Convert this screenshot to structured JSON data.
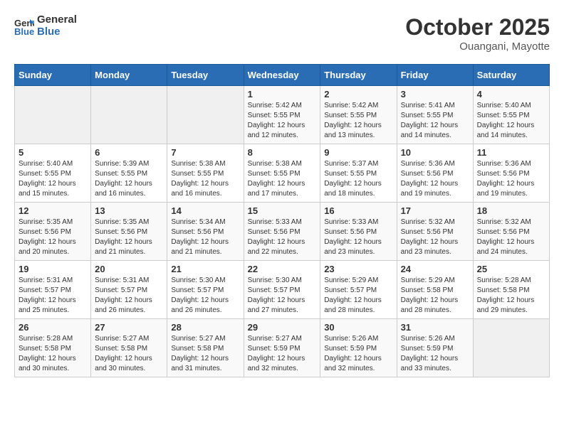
{
  "header": {
    "logo_line1": "General",
    "logo_line2": "Blue",
    "title": "October 2025",
    "subtitle": "Ouangani, Mayotte"
  },
  "days_of_week": [
    "Sunday",
    "Monday",
    "Tuesday",
    "Wednesday",
    "Thursday",
    "Friday",
    "Saturday"
  ],
  "weeks": [
    [
      {
        "day": "",
        "info": ""
      },
      {
        "day": "",
        "info": ""
      },
      {
        "day": "",
        "info": ""
      },
      {
        "day": "1",
        "info": "Sunrise: 5:42 AM\nSunset: 5:55 PM\nDaylight: 12 hours\nand 12 minutes."
      },
      {
        "day": "2",
        "info": "Sunrise: 5:42 AM\nSunset: 5:55 PM\nDaylight: 12 hours\nand 13 minutes."
      },
      {
        "day": "3",
        "info": "Sunrise: 5:41 AM\nSunset: 5:55 PM\nDaylight: 12 hours\nand 14 minutes."
      },
      {
        "day": "4",
        "info": "Sunrise: 5:40 AM\nSunset: 5:55 PM\nDaylight: 12 hours\nand 14 minutes."
      }
    ],
    [
      {
        "day": "5",
        "info": "Sunrise: 5:40 AM\nSunset: 5:55 PM\nDaylight: 12 hours\nand 15 minutes."
      },
      {
        "day": "6",
        "info": "Sunrise: 5:39 AM\nSunset: 5:55 PM\nDaylight: 12 hours\nand 16 minutes."
      },
      {
        "day": "7",
        "info": "Sunrise: 5:38 AM\nSunset: 5:55 PM\nDaylight: 12 hours\nand 16 minutes."
      },
      {
        "day": "8",
        "info": "Sunrise: 5:38 AM\nSunset: 5:55 PM\nDaylight: 12 hours\nand 17 minutes."
      },
      {
        "day": "9",
        "info": "Sunrise: 5:37 AM\nSunset: 5:55 PM\nDaylight: 12 hours\nand 18 minutes."
      },
      {
        "day": "10",
        "info": "Sunrise: 5:36 AM\nSunset: 5:56 PM\nDaylight: 12 hours\nand 19 minutes."
      },
      {
        "day": "11",
        "info": "Sunrise: 5:36 AM\nSunset: 5:56 PM\nDaylight: 12 hours\nand 19 minutes."
      }
    ],
    [
      {
        "day": "12",
        "info": "Sunrise: 5:35 AM\nSunset: 5:56 PM\nDaylight: 12 hours\nand 20 minutes."
      },
      {
        "day": "13",
        "info": "Sunrise: 5:35 AM\nSunset: 5:56 PM\nDaylight: 12 hours\nand 21 minutes."
      },
      {
        "day": "14",
        "info": "Sunrise: 5:34 AM\nSunset: 5:56 PM\nDaylight: 12 hours\nand 21 minutes."
      },
      {
        "day": "15",
        "info": "Sunrise: 5:33 AM\nSunset: 5:56 PM\nDaylight: 12 hours\nand 22 minutes."
      },
      {
        "day": "16",
        "info": "Sunrise: 5:33 AM\nSunset: 5:56 PM\nDaylight: 12 hours\nand 23 minutes."
      },
      {
        "day": "17",
        "info": "Sunrise: 5:32 AM\nSunset: 5:56 PM\nDaylight: 12 hours\nand 23 minutes."
      },
      {
        "day": "18",
        "info": "Sunrise: 5:32 AM\nSunset: 5:56 PM\nDaylight: 12 hours\nand 24 minutes."
      }
    ],
    [
      {
        "day": "19",
        "info": "Sunrise: 5:31 AM\nSunset: 5:57 PM\nDaylight: 12 hours\nand 25 minutes."
      },
      {
        "day": "20",
        "info": "Sunrise: 5:31 AM\nSunset: 5:57 PM\nDaylight: 12 hours\nand 26 minutes."
      },
      {
        "day": "21",
        "info": "Sunrise: 5:30 AM\nSunset: 5:57 PM\nDaylight: 12 hours\nand 26 minutes."
      },
      {
        "day": "22",
        "info": "Sunrise: 5:30 AM\nSunset: 5:57 PM\nDaylight: 12 hours\nand 27 minutes."
      },
      {
        "day": "23",
        "info": "Sunrise: 5:29 AM\nSunset: 5:57 PM\nDaylight: 12 hours\nand 28 minutes."
      },
      {
        "day": "24",
        "info": "Sunrise: 5:29 AM\nSunset: 5:58 PM\nDaylight: 12 hours\nand 28 minutes."
      },
      {
        "day": "25",
        "info": "Sunrise: 5:28 AM\nSunset: 5:58 PM\nDaylight: 12 hours\nand 29 minutes."
      }
    ],
    [
      {
        "day": "26",
        "info": "Sunrise: 5:28 AM\nSunset: 5:58 PM\nDaylight: 12 hours\nand 30 minutes."
      },
      {
        "day": "27",
        "info": "Sunrise: 5:27 AM\nSunset: 5:58 PM\nDaylight: 12 hours\nand 30 minutes."
      },
      {
        "day": "28",
        "info": "Sunrise: 5:27 AM\nSunset: 5:58 PM\nDaylight: 12 hours\nand 31 minutes."
      },
      {
        "day": "29",
        "info": "Sunrise: 5:27 AM\nSunset: 5:59 PM\nDaylight: 12 hours\nand 32 minutes."
      },
      {
        "day": "30",
        "info": "Sunrise: 5:26 AM\nSunset: 5:59 PM\nDaylight: 12 hours\nand 32 minutes."
      },
      {
        "day": "31",
        "info": "Sunrise: 5:26 AM\nSunset: 5:59 PM\nDaylight: 12 hours\nand 33 minutes."
      },
      {
        "day": "",
        "info": ""
      }
    ]
  ]
}
